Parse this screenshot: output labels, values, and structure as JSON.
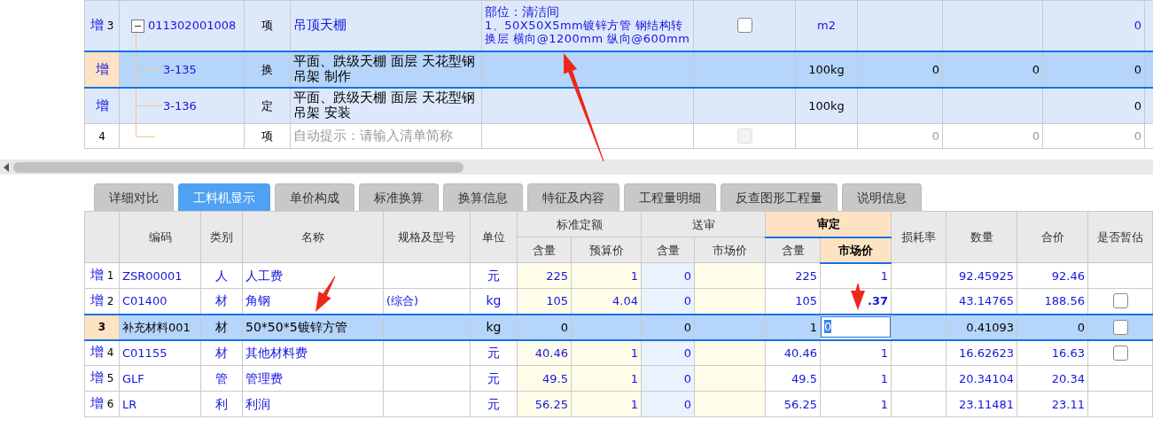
{
  "top_table": {
    "rows": [
      {
        "kind": "bill",
        "marker": "增",
        "index": "3",
        "code": "011302001008",
        "expanded": true,
        "type": "项",
        "name": "吊顶天棚",
        "feature": [
          "部位：清洁间",
          "1、50X50X5mm镀锌方管 钢结构转换层 横向@1200mm 纵向@600mm"
        ],
        "checkbox": {
          "checked": false,
          "disabled": false
        },
        "unit": "m2",
        "values": {
          "column_10": "0"
        },
        "selected": false
      },
      {
        "kind": "quota",
        "marker": "增",
        "code": "3-135",
        "type": "换",
        "name": "平面、跌级天棚 面层 天花型钢吊架 制作",
        "unit": "100kg",
        "values": {
          "column_8": "0",
          "column_9": "0",
          "column_10": "0"
        },
        "selected": true
      },
      {
        "kind": "quota",
        "marker": "增",
        "code": "3-136",
        "type": "定",
        "name": "平面、跌级天棚 面层 天花型钢吊架 安装",
        "unit": "100kg",
        "values": {
          "column_10": "0"
        },
        "selected": false
      },
      {
        "kind": "hint",
        "index": "4",
        "type": "项",
        "name": "自动提示：请输入清单简称",
        "checkbox": {
          "checked": false,
          "disabled": true
        },
        "values": {
          "column_8": "0",
          "column_9": "0",
          "column_10": "0"
        },
        "selected": false
      }
    ]
  },
  "tabs": [
    {
      "label": "详细对比",
      "selected": false
    },
    {
      "label": "工料机显示",
      "selected": true
    },
    {
      "label": "单价构成",
      "selected": false
    },
    {
      "label": "标准换算",
      "selected": false
    },
    {
      "label": "换算信息",
      "selected": false
    },
    {
      "label": "特征及内容",
      "selected": false
    },
    {
      "label": "工程量明细",
      "selected": false
    },
    {
      "label": "反查图形工程量",
      "selected": false
    },
    {
      "label": "说明信息",
      "selected": false
    }
  ],
  "resource_table": {
    "columns": [
      {
        "label": "编码"
      },
      {
        "label": "类别"
      },
      {
        "label": "名称"
      },
      {
        "label": "规格及型号"
      },
      {
        "label": "单位"
      },
      {
        "label": "标准定额",
        "colspan": 2,
        "subcolumns": [
          {
            "label": "含量",
            "selected": false
          },
          {
            "label": "预算价",
            "selected": false
          }
        ]
      },
      {
        "label": "送审",
        "colspan": 2,
        "subcolumns": [
          {
            "label": "含量",
            "selected": false
          },
          {
            "label": "市场价",
            "selected": false
          }
        ]
      },
      {
        "label": "审定",
        "colspan": 2,
        "subcolumns": [
          {
            "label": "含量",
            "selected": false
          },
          {
            "label": "市场价",
            "selected": true
          }
        ]
      },
      {
        "label": "损耗率"
      },
      {
        "label": "数量"
      },
      {
        "label": "合价"
      },
      {
        "label": "是否暂估"
      }
    ],
    "rows": [
      {
        "kind": "standard",
        "marker": "增",
        "index": "1",
        "cells": [
          "ZSR00001",
          "人",
          "人工费",
          null,
          "元",
          "225",
          "1",
          "0",
          null,
          "225",
          "1",
          null,
          "92.45925",
          "92.46"
        ],
        "selected": false
      },
      {
        "kind": "standard",
        "marker": "增",
        "index": "2",
        "cells": [
          "C01400",
          "材",
          "角钢",
          "(综合)",
          "kg",
          "105",
          "4.04",
          "0",
          null,
          "105",
          ".37",
          null,
          "43.14765",
          "188.56"
        ],
        "price_changed": true,
        "provisional": {
          "checked": false
        },
        "selected": false
      },
      {
        "kind": "supplement",
        "index": "3",
        "cells": [
          "补充材料001",
          "材",
          "50*50*5镀锌方管",
          null,
          "kg",
          "0",
          null,
          "0",
          null,
          "1",
          "0",
          null,
          "0.41093",
          "0"
        ],
        "editing": true,
        "provisional": {
          "checked": false
        },
        "selected": true
      },
      {
        "kind": "standard",
        "marker": "增",
        "index": "4",
        "cells": [
          "C01155",
          "材",
          "其他材料费",
          null,
          "元",
          "40.46",
          "1",
          "0",
          null,
          "40.46",
          "1",
          null,
          "16.62623",
          "16.63"
        ],
        "provisional": {
          "checked": false
        },
        "selected": false
      },
      {
        "kind": "standard",
        "marker": "增",
        "index": "5",
        "cells": [
          "GLF",
          "管",
          "管理费",
          null,
          "元",
          "49.5",
          "1",
          "0",
          null,
          "49.5",
          "1",
          null,
          "20.34104",
          "20.34"
        ],
        "selected": false
      },
      {
        "kind": "standard",
        "marker": "增",
        "index": "6",
        "cells": [
          "LR",
          "利",
          "利润",
          null,
          "元",
          "56.25",
          "1",
          "0",
          null,
          "56.25",
          "1",
          null,
          "23.11481",
          "23.11"
        ],
        "selected": false
      }
    ]
  }
}
